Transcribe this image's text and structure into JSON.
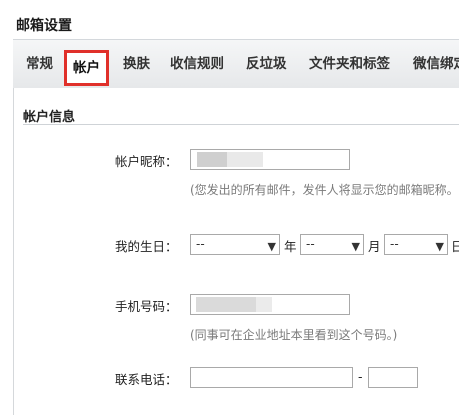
{
  "header": {
    "title": "邮箱设置"
  },
  "tabs": [
    {
      "label": "常规"
    },
    {
      "label": "帐户"
    },
    {
      "label": "换肤"
    },
    {
      "label": "收信规则"
    },
    {
      "label": "反垃圾"
    },
    {
      "label": "文件夹和标签"
    },
    {
      "label": "微信绑定"
    }
  ],
  "active_tab": "帐户",
  "section": {
    "title": "帐户信息"
  },
  "form": {
    "nickname": {
      "label": "帐户昵称：",
      "value": "",
      "hint": "(您发出的所有邮件，发件人将显示您的邮箱昵称。"
    },
    "birthday": {
      "label": "我的生日：",
      "year_value": "--",
      "year_unit": "年",
      "month_value": "--",
      "month_unit": "月",
      "day_value": "--",
      "day_unit": "日"
    },
    "mobile": {
      "label": "手机号码：",
      "value": "",
      "hint": "(同事可在企业地址本里看到这个号码。)"
    },
    "phone": {
      "label": "联系电话：",
      "separator": "-"
    }
  },
  "colors": {
    "active_tab_outline": "#e0302a",
    "hint_text": "#7a7a7a"
  }
}
